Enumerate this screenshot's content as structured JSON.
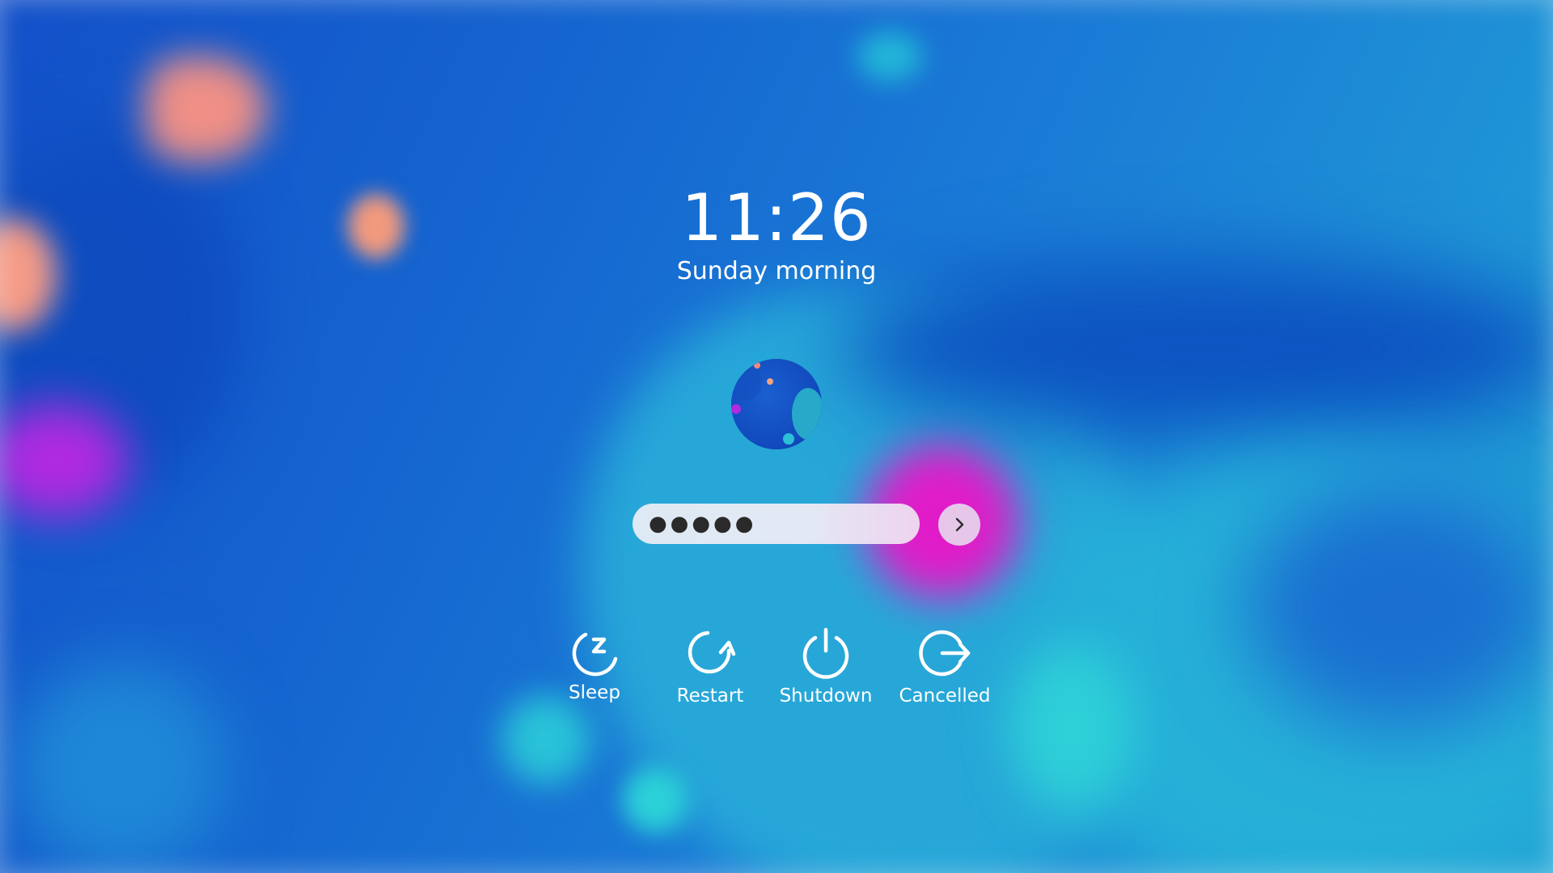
{
  "lockscreen": {
    "time": "11:26",
    "date_text": "Sunday morning"
  },
  "password": {
    "masked_value": "●●●●●",
    "submit_icon": "chevron-right-icon"
  },
  "actions": [
    {
      "label": "Sleep",
      "icon": "sleep-icon"
    },
    {
      "label": "Restart",
      "icon": "restart-icon"
    },
    {
      "label": "Shutdown",
      "icon": "power-icon"
    },
    {
      "label": "Cancelled",
      "icon": "logout-arrow-icon"
    }
  ],
  "colors": {
    "text": "#ffffff",
    "field_bg": "#e3e9f4",
    "submit_bg": "#e6c7ea",
    "wallpaper_primary": "#1565cf",
    "wallpaper_accent": "#e01cc8"
  }
}
